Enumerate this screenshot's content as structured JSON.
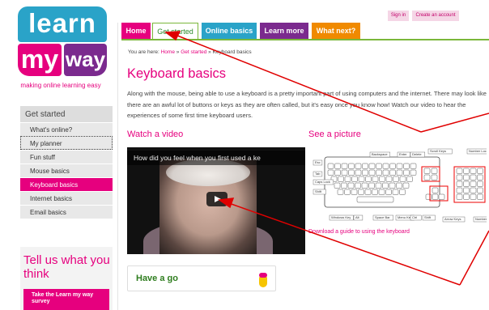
{
  "logo": {
    "learn": "learn",
    "my": "my",
    "way": "way",
    "tagline": "making online learning easy"
  },
  "toplinks": {
    "signin": "Sign in",
    "create": "Create an account"
  },
  "tabs": [
    "Home",
    "Get started",
    "Online basics",
    "Learn more",
    "What next?"
  ],
  "breadcrumb": {
    "prefix": "You are here:",
    "home": "Home",
    "sep": "»",
    "section": "Get started",
    "current": "Keyboard basics"
  },
  "sidebar": {
    "heading": "Get started",
    "items": [
      "What's online?",
      "My planner",
      "Fun stuff",
      "Mouse basics",
      "Keyboard basics",
      "Internet basics",
      "Email basics"
    ]
  },
  "page": {
    "title": "Keyboard basics",
    "intro": "Along with the mouse, being able to use a keyboard is a pretty important part of using computers and the internet. There may look like there are an awful lot of buttons or keys as they are often called, but it's easy once you know how! Watch our video to hear the experiences of some first time keyboard users."
  },
  "video": {
    "heading": "Watch a video",
    "caption": "How did you feel when you first used a ke"
  },
  "picture": {
    "heading": "See a picture",
    "download": "Download a guide to using the keyboard"
  },
  "keyboard_labels": [
    "Backspace",
    "Enter",
    "Delete",
    "Scroll Keys",
    "Number Lock",
    "Esc",
    "Tab",
    "Caps Lock",
    "Shift",
    "Windows Key",
    "Alt",
    "Space Bar",
    "Menu Key",
    "Ctrl",
    "Shift",
    "Arrow Keys",
    "Number Keys"
  ],
  "cta": {
    "have_a_go": "Have a go"
  },
  "survey": {
    "title": "Tell us what you think",
    "button": "Take the Learn my way survey"
  },
  "colors": {
    "pink": "#e6007e",
    "blue": "#2aa3c8",
    "purple": "#7b2a8e",
    "orange": "#f08a00",
    "green": "#7ab73a",
    "arrow": "#e00000"
  }
}
